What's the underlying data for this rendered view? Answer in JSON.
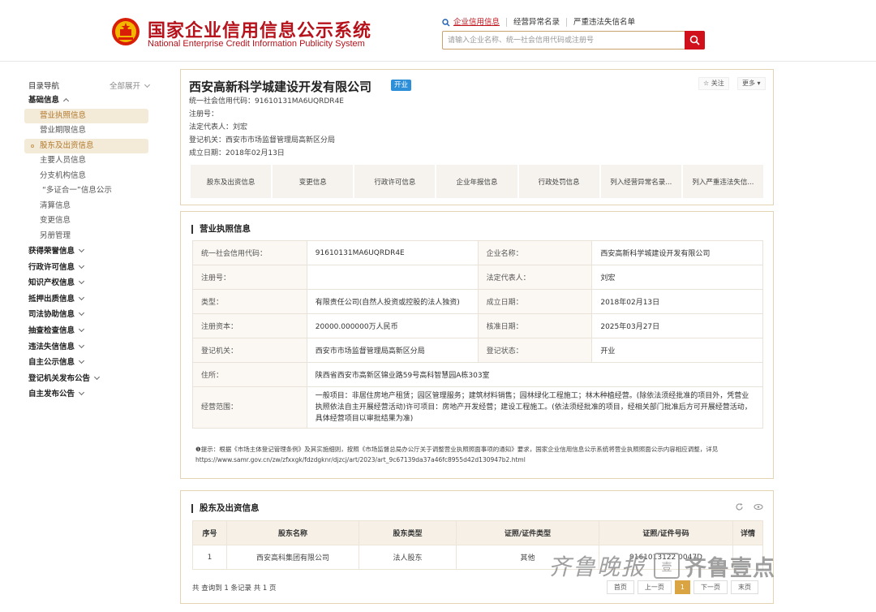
{
  "header": {
    "title_cn": "国家企业信用信息公示系统",
    "title_en": "National Enterprise Credit Information Publicity System",
    "nav": [
      "企业信用信息",
      "经营异常名录",
      "严重违法失信名单"
    ],
    "search_placeholder": "请输入企业名称、统一社会信用代码或注册号"
  },
  "sidebar": {
    "heading": "目录导航",
    "expand_all": "全部展开",
    "basic_group": "基础信息",
    "basic_items": [
      "营业执照信息",
      "营业期限信息",
      "股东及出资信息",
      "主要人员信息",
      "分支机构信息",
      "“多证合一”信息公示",
      "清算信息",
      "变更信息",
      "另册管理"
    ],
    "groups": [
      "获得荣誉信息",
      "行政许可信息",
      "知识产权信息",
      "抵押出质信息",
      "司法协助信息",
      "抽查检查信息",
      "违法失信信息",
      "自主公示信息",
      "登记机关发布公告",
      "自主发布公告"
    ]
  },
  "company": {
    "name": "西安高新科学城建设开发有限公司",
    "status": "开业",
    "credit_code_line": "统一社会信用代码：91610131MA6UQRDR4E",
    "reg_no_line": "注册号：",
    "legal_rep_line": "法定代表人：刘宏",
    "authority_line": "登记机关：西安市市场监督管理局高新区分局",
    "date_line": "成立日期：2018年02月13日",
    "follow": "☆ 关注",
    "more": "更多",
    "quick_tabs": [
      "股东及出资信息",
      "变更信息",
      "行政许可信息",
      "企业年报信息",
      "行政处罚信息",
      "列入经营异常名录...",
      "列入严重违法失信..."
    ]
  },
  "license": {
    "title": "营业执照信息",
    "rows": [
      [
        "统一社会信用代码：",
        "91610131MA6UQRDR4E",
        "企业名称：",
        "西安高新科学城建设开发有限公司"
      ],
      [
        "注册号：",
        "",
        "法定代表人：",
        "刘宏"
      ],
      [
        "类型：",
        "有限责任公司(自然人投资或控股的法人独资)",
        "成立日期：",
        "2018年02月13日"
      ],
      [
        "注册资本：",
        "20000.000000万人民币",
        "核准日期：",
        "2025年03月27日"
      ],
      [
        "登记机关：",
        "西安市市场监督管理局高新区分局",
        "登记状态：",
        "开业"
      ]
    ],
    "address_label": "住所：",
    "address_value": "陕西省西安市高新区锦业路59号高科智慧园A栋303室",
    "scope_label": "经营范围：",
    "scope_value": "一般项目：非居住房地产租赁；园区管理服务；建筑材料销售；园林绿化工程施工；林木种植经营。(除依法须经批准的项目外，凭营业执照依法自主开展经营活动)许可项目：房地产开发经营；建设工程施工。(依法须经批准的项目，经相关部门批准后方可开展经营活动，具体经营项目以审批结果为准)",
    "note": "❶提示：根据《市场主体登记管理条例》及其实施细则，按照《市场监督总局办公厅关于调整营业执照照面事项的通知》要求，国家企业信用信息公示系统将营业执照照面公示内容相应调整，详见https://www.samr.gov.cn/zw/zfxxgk/fdzdgknr/djzcj/art/2023/art_9c67139da37a46fc8955d42d130947b2.html"
  },
  "shareholders": {
    "title": "股东及出资信息",
    "columns": [
      "序号",
      "股东名称",
      "股东类型",
      "证照/证件类型",
      "证照/证件号码",
      "详情"
    ],
    "rows": [
      [
        "1",
        "西安高科集团有限公司",
        "法人股东",
        "其他",
        "9161013122 0047D",
        ""
      ]
    ],
    "summary": "共 查询到 1 条记录 共 1 页",
    "pager": [
      "首页",
      "上一页",
      "1",
      "下一页",
      "末页"
    ]
  },
  "watermark": {
    "brush_text": "齐鲁晚报",
    "box_text": "壹",
    "name": "齐鲁壹点"
  },
  "colors": {
    "brand_red": "#b5121b",
    "accent_gold": "#d9a441",
    "status_blue": "#2e8fd9"
  }
}
